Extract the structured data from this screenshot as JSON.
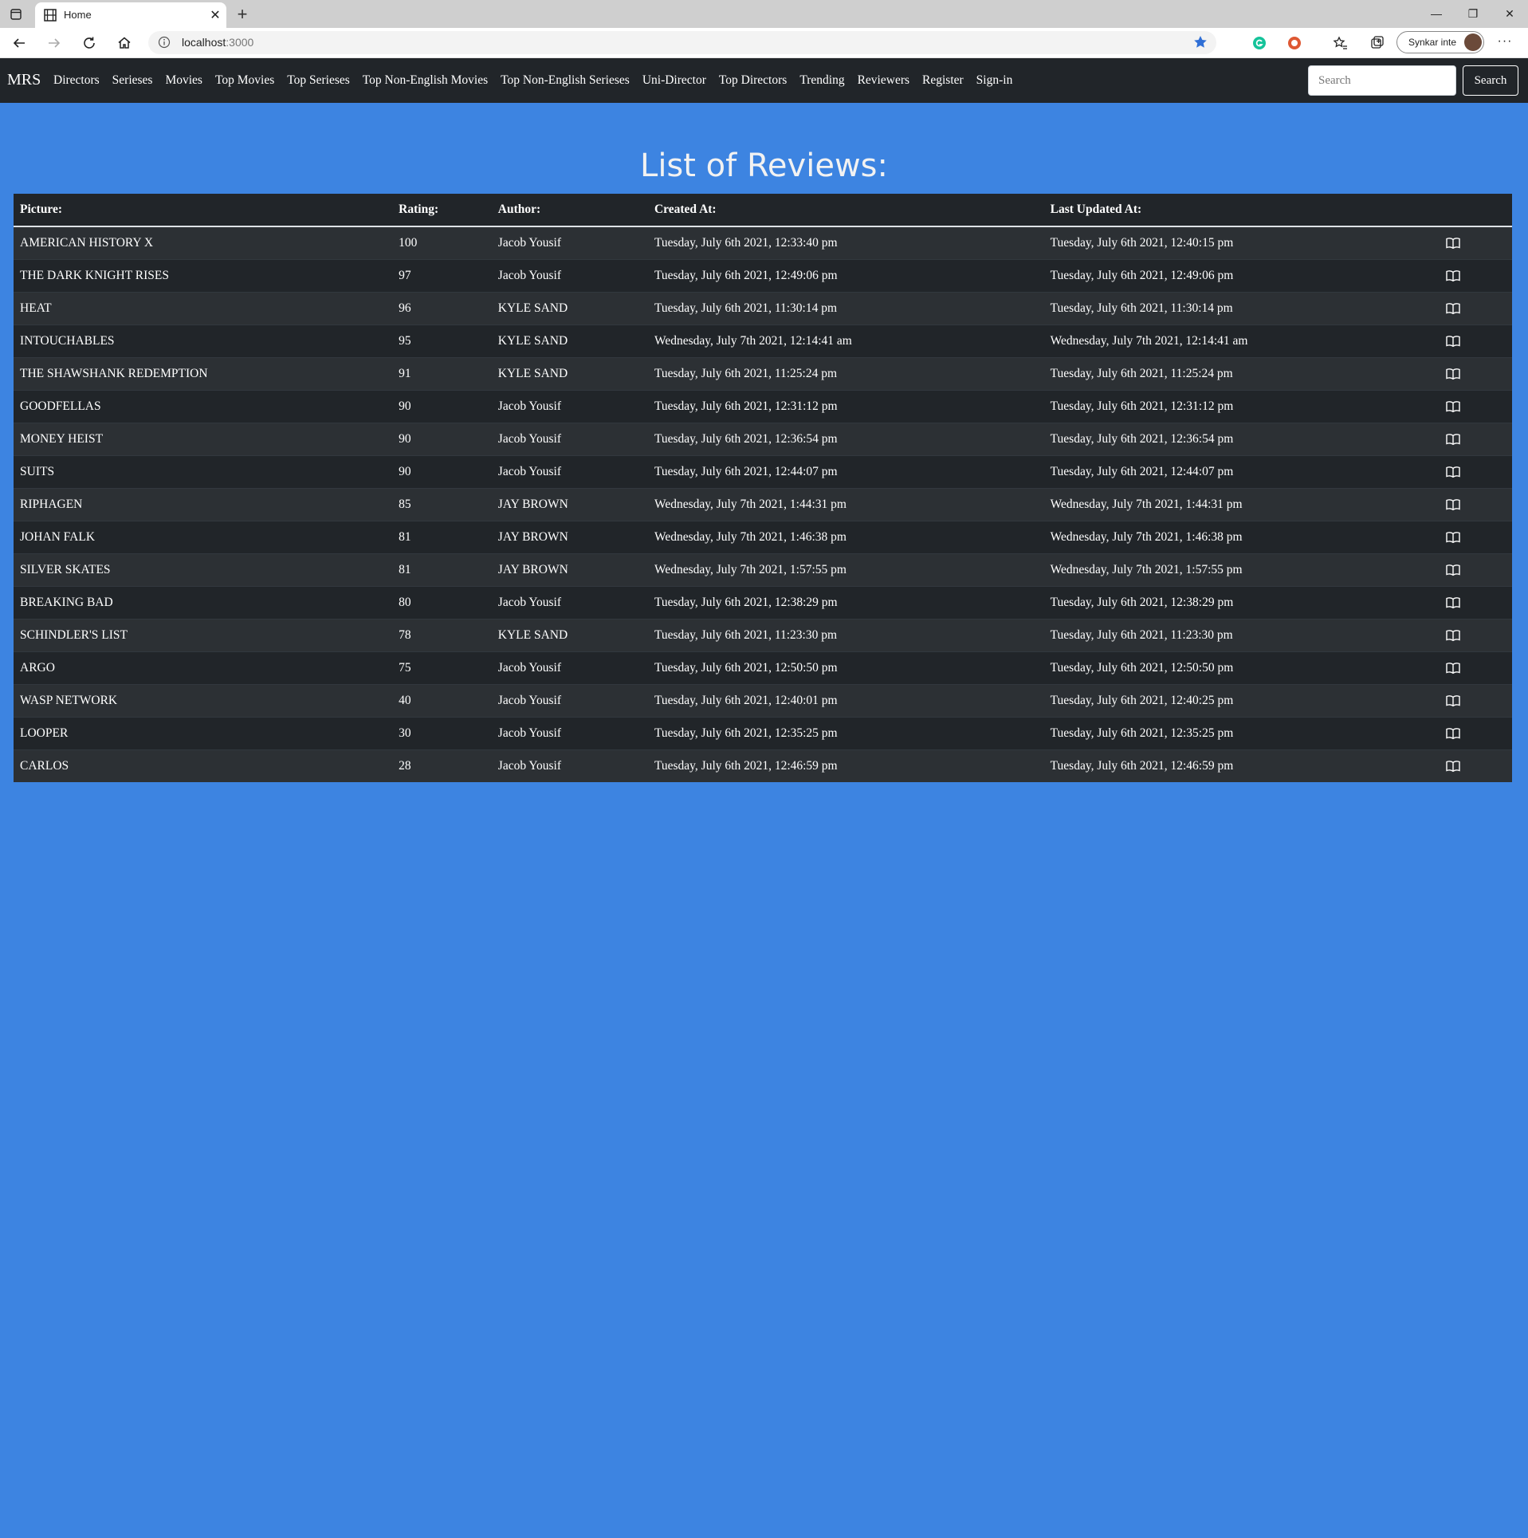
{
  "browser": {
    "tab_title": "Home",
    "url_host": "localhost",
    "url_port": ":3000",
    "profile_name": "Synkar inte",
    "more_label": "···"
  },
  "navbar": {
    "brand": "MRS",
    "links": [
      "Directors",
      "Serieses",
      "Movies",
      "Top Movies",
      "Top Serieses",
      "Top Non-English Movies",
      "Top Non-English Serieses",
      "Uni-Director",
      "Top Directors",
      "Trending",
      "Reviewers",
      "Register",
      "Sign-in"
    ],
    "search_placeholder": "Search",
    "search_button": "Search"
  },
  "main": {
    "title": "List of Reviews:",
    "columns": [
      "Picture:",
      "Rating:",
      "Author:",
      "Created At:",
      "Last Updated At:"
    ],
    "rows": [
      {
        "picture": "AMERICAN HISTORY X",
        "rating": "100",
        "author": "Jacob Yousif",
        "created": "Tuesday, July 6th 2021, 12:33:40 pm",
        "updated": "Tuesday, July 6th 2021, 12:40:15 pm"
      },
      {
        "picture": "THE DARK KNIGHT RISES",
        "rating": "97",
        "author": "Jacob Yousif",
        "created": "Tuesday, July 6th 2021, 12:49:06 pm",
        "updated": "Tuesday, July 6th 2021, 12:49:06 pm"
      },
      {
        "picture": "HEAT",
        "rating": "96",
        "author": "KYLE SAND",
        "created": "Tuesday, July 6th 2021, 11:30:14 pm",
        "updated": "Tuesday, July 6th 2021, 11:30:14 pm"
      },
      {
        "picture": "INTOUCHABLES",
        "rating": "95",
        "author": "KYLE SAND",
        "created": "Wednesday, July 7th 2021, 12:14:41 am",
        "updated": "Wednesday, July 7th 2021, 12:14:41 am"
      },
      {
        "picture": "THE SHAWSHANK REDEMPTION",
        "rating": "91",
        "author": "KYLE SAND",
        "created": "Tuesday, July 6th 2021, 11:25:24 pm",
        "updated": "Tuesday, July 6th 2021, 11:25:24 pm"
      },
      {
        "picture": "GOODFELLAS",
        "rating": "90",
        "author": "Jacob Yousif",
        "created": "Tuesday, July 6th 2021, 12:31:12 pm",
        "updated": "Tuesday, July 6th 2021, 12:31:12 pm"
      },
      {
        "picture": "MONEY HEIST",
        "rating": "90",
        "author": "Jacob Yousif",
        "created": "Tuesday, July 6th 2021, 12:36:54 pm",
        "updated": "Tuesday, July 6th 2021, 12:36:54 pm"
      },
      {
        "picture": "SUITS",
        "rating": "90",
        "author": "Jacob Yousif",
        "created": "Tuesday, July 6th 2021, 12:44:07 pm",
        "updated": "Tuesday, July 6th 2021, 12:44:07 pm"
      },
      {
        "picture": "RIPHAGEN",
        "rating": "85",
        "author": "JAY BROWN",
        "created": "Wednesday, July 7th 2021, 1:44:31 pm",
        "updated": "Wednesday, July 7th 2021, 1:44:31 pm"
      },
      {
        "picture": "JOHAN FALK",
        "rating": "81",
        "author": "JAY BROWN",
        "created": "Wednesday, July 7th 2021, 1:46:38 pm",
        "updated": "Wednesday, July 7th 2021, 1:46:38 pm"
      },
      {
        "picture": "SILVER SKATES",
        "rating": "81",
        "author": "JAY BROWN",
        "created": "Wednesday, July 7th 2021, 1:57:55 pm",
        "updated": "Wednesday, July 7th 2021, 1:57:55 pm"
      },
      {
        "picture": "BREAKING BAD",
        "rating": "80",
        "author": "Jacob Yousif",
        "created": "Tuesday, July 6th 2021, 12:38:29 pm",
        "updated": "Tuesday, July 6th 2021, 12:38:29 pm"
      },
      {
        "picture": "SCHINDLER'S LIST",
        "rating": "78",
        "author": "KYLE SAND",
        "created": "Tuesday, July 6th 2021, 11:23:30 pm",
        "updated": "Tuesday, July 6th 2021, 11:23:30 pm"
      },
      {
        "picture": "ARGO",
        "rating": "75",
        "author": "Jacob Yousif",
        "created": "Tuesday, July 6th 2021, 12:50:50 pm",
        "updated": "Tuesday, July 6th 2021, 12:50:50 pm"
      },
      {
        "picture": "WASP NETWORK",
        "rating": "40",
        "author": "Jacob Yousif",
        "created": "Tuesday, July 6th 2021, 12:40:01 pm",
        "updated": "Tuesday, July 6th 2021, 12:40:25 pm"
      },
      {
        "picture": "LOOPER",
        "rating": "30",
        "author": "Jacob Yousif",
        "created": "Tuesday, July 6th 2021, 12:35:25 pm",
        "updated": "Tuesday, July 6th 2021, 12:35:25 pm"
      },
      {
        "picture": "CARLOS",
        "rating": "28",
        "author": "Jacob Yousif",
        "created": "Tuesday, July 6th 2021, 12:46:59 pm",
        "updated": "Tuesday, July 6th 2021, 12:46:59 pm"
      }
    ],
    "row_action_icon": "book-icon"
  },
  "colors": {
    "page_background": "#3d84e1",
    "navbar_background": "#212529",
    "table_row_dark": "#212529",
    "table_row_striped": "#2c3034",
    "title_text": "#f2f2f2"
  }
}
